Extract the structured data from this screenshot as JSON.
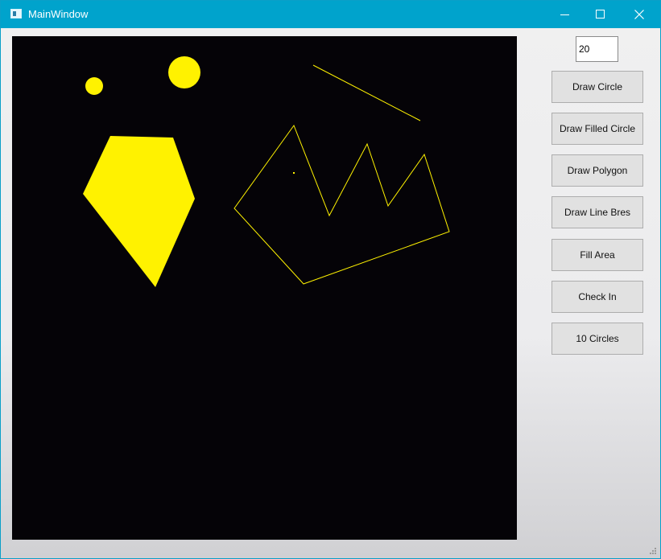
{
  "window": {
    "title": "MainWindow",
    "icons": {
      "app": "app-window-icon",
      "minimize": "minimize-icon",
      "maximize": "maximize-icon",
      "close": "close-icon"
    },
    "colors": {
      "titlebar": "#00a3cc",
      "canvas_background": "#050307",
      "drawing": "#fff200"
    }
  },
  "controls": {
    "size_input_value": "20",
    "buttons": [
      {
        "id": "draw-circle-button",
        "label": "Draw Circle"
      },
      {
        "id": "draw-filled-circle-button",
        "label": "Draw Filled Circle"
      },
      {
        "id": "draw-polygon-button",
        "label": "Draw Polygon"
      },
      {
        "id": "draw-line-bres-button",
        "label": "Draw Line Bres"
      },
      {
        "id": "fill-area-button",
        "label": "Fill Area"
      },
      {
        "id": "check-in-button",
        "label": "Check In"
      },
      {
        "id": "ten-circles-button",
        "label": "10 Circles"
      }
    ]
  }
}
